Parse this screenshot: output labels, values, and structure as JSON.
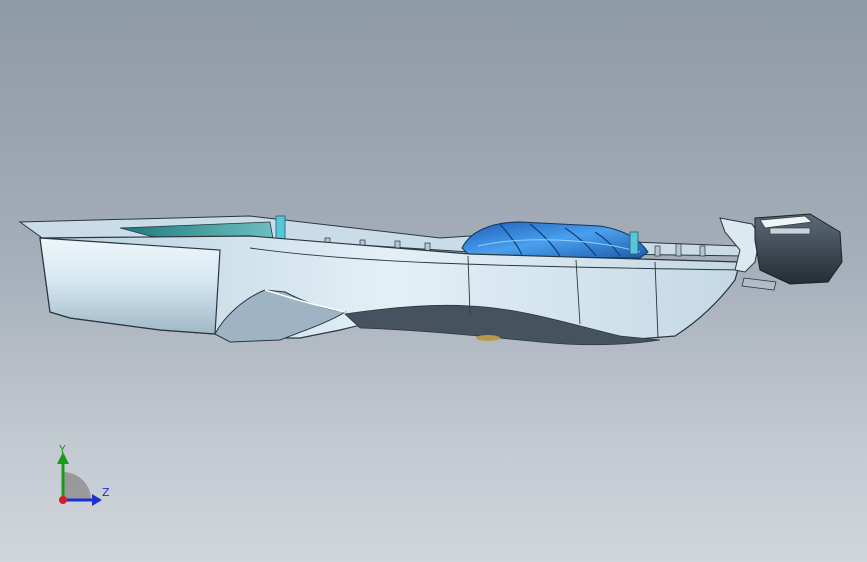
{
  "viewport": {
    "background_top": "#8f9aa7",
    "background_bottom": "#d1d6dc"
  },
  "model": {
    "body_color": "#dcecf4",
    "highlight_color": "#2c7fd6",
    "interior_color": "#2a8a8a",
    "edge_color": "#2a3640",
    "dark_part_color": "#3c4650"
  },
  "triad": {
    "y_label": "Y",
    "z_label": "Z",
    "y_color": "#1a9a1a",
    "z_color": "#2030d0",
    "x_color": "#d02020"
  }
}
